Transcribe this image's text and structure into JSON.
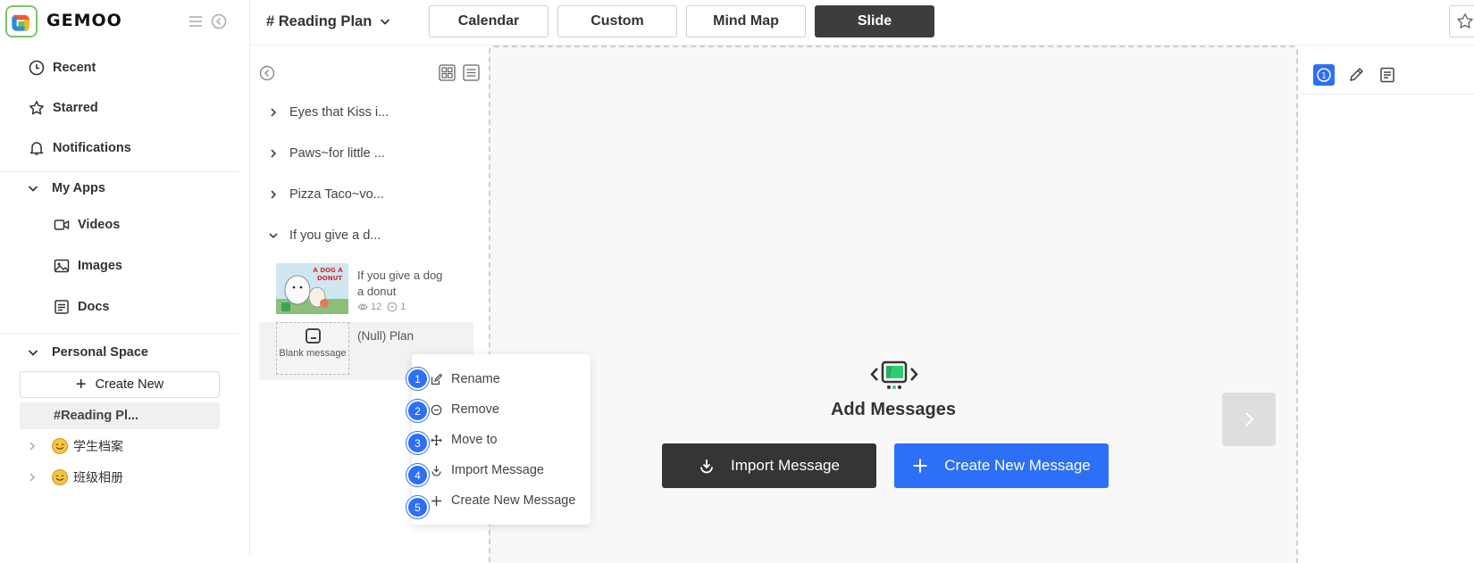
{
  "app": {
    "brand": "GEMOO"
  },
  "sidebar": {
    "nav": [
      {
        "label": "Recent",
        "icon": "clock-icon"
      },
      {
        "label": "Starred",
        "icon": "star-icon"
      },
      {
        "label": "Notifications",
        "icon": "bell-icon"
      }
    ],
    "my_apps": {
      "label": "My Apps",
      "items": [
        {
          "label": "Videos",
          "icon": "video-icon"
        },
        {
          "label": "Images",
          "icon": "image-icon"
        },
        {
          "label": "Docs",
          "icon": "doc-icon"
        }
      ]
    },
    "personal_space": {
      "label": "Personal Space",
      "create_new": "Create New",
      "active_item": "#Reading Pl...",
      "items": [
        {
          "label": "学生档案",
          "icon": "smile-emoji-icon"
        },
        {
          "label": "班级相册",
          "icon": "smile-emoji-icon"
        }
      ]
    }
  },
  "topbar": {
    "title": "# Reading Plan",
    "tabs": [
      {
        "label": "Calendar",
        "active": false
      },
      {
        "label": "Custom",
        "active": false
      },
      {
        "label": "Mind Map",
        "active": false
      },
      {
        "label": "Slide",
        "active": true
      }
    ]
  },
  "outline": {
    "items": [
      {
        "label": "Eyes that Kiss i...",
        "expanded": false
      },
      {
        "label": "Paws~for little ...",
        "expanded": false
      },
      {
        "label": "Pizza Taco~vo...",
        "expanded": false
      },
      {
        "label": "If you give a d...",
        "expanded": true
      }
    ],
    "book": {
      "title": "If you give a dog a donut",
      "thumb_text": "A DOG A DONUT",
      "views": "12",
      "comments": "1"
    },
    "blank_card": {
      "label": "Blank message",
      "plan_label": "(Null) Plan"
    }
  },
  "context_menu": {
    "items": [
      {
        "badge": "1",
        "label": "Rename",
        "icon": "edit-icon"
      },
      {
        "badge": "2",
        "label": "Remove",
        "icon": "minus-circle-icon"
      },
      {
        "badge": "3",
        "label": "Move to",
        "icon": "move-icon"
      },
      {
        "badge": "4",
        "label": "Import Message",
        "icon": "import-icon"
      },
      {
        "badge": "5",
        "label": "Create New Message",
        "icon": "plus-icon"
      }
    ]
  },
  "canvas": {
    "title": "Add Messages",
    "import_label": "Import Message",
    "create_label": "Create New Message"
  },
  "right_panel": {
    "tools": [
      {
        "icon": "number-one-icon",
        "badge": "1",
        "active": true
      },
      {
        "icon": "pencil-icon",
        "active": false
      },
      {
        "icon": "notes-icon",
        "active": false
      }
    ]
  },
  "colors": {
    "accent": "#2d6ff7",
    "dark": "#353535",
    "active_tab": "#3d3d3d"
  }
}
